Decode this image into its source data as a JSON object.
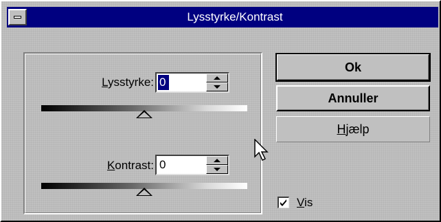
{
  "window": {
    "title": "Lysstyrke/Kontrast"
  },
  "controls": {
    "brightness": {
      "label_mnemonic": "L",
      "label_rest": "ysstyrke:",
      "value": "0",
      "slider_level": 0.5
    },
    "contrast": {
      "label_mnemonic": "K",
      "label_rest": "ontrast:",
      "value": "0",
      "slider_level": 0.5
    }
  },
  "buttons": {
    "ok": "Ok",
    "cancel": "Annuller",
    "help_mnemonic": "H",
    "help_rest": "jælp"
  },
  "preview": {
    "label_mnemonic": "V",
    "label_rest": "is",
    "checked": true
  },
  "icons": {
    "system_menu": "system-menu-icon",
    "spin_up": "arrow-up-icon",
    "spin_down": "arrow-down-icon",
    "cursor": "mouse-pointer-icon",
    "check": "check-icon"
  },
  "colors": {
    "titlebar": "#000080",
    "face": "#c0c0c0",
    "selection": "#000080"
  }
}
